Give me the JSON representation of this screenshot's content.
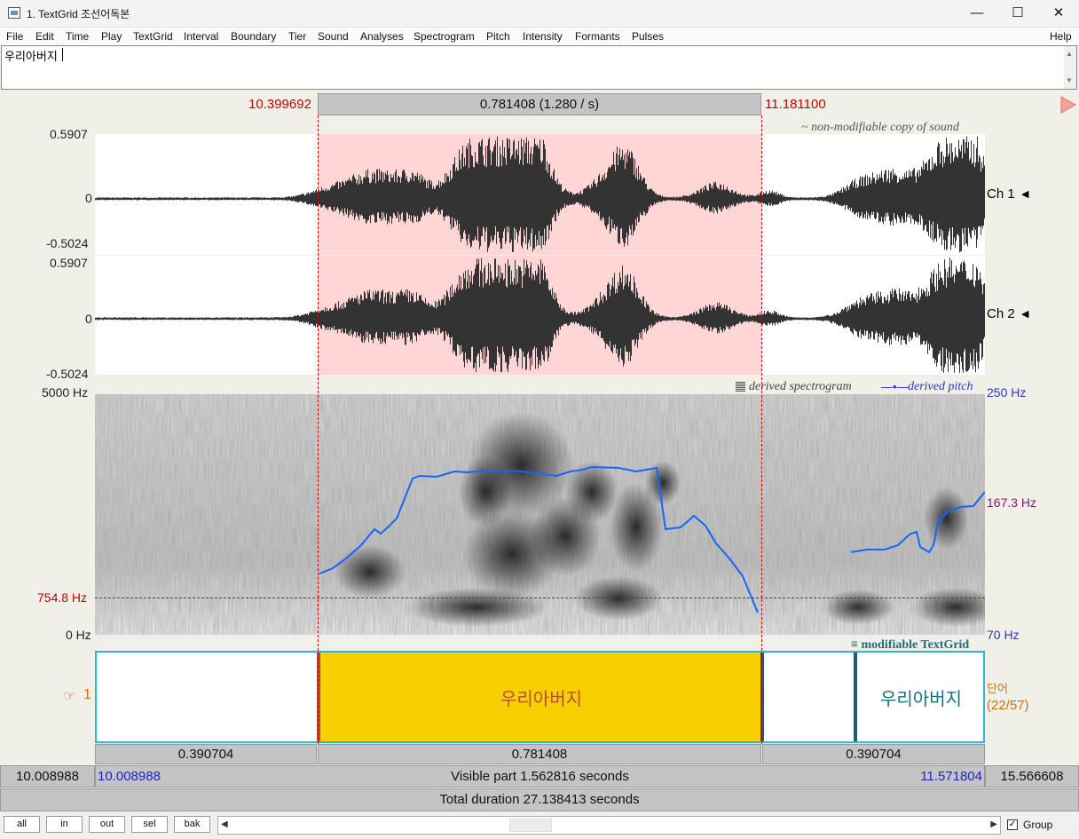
{
  "window": {
    "title": "1. TextGrid 조선어독본",
    "minimize": "—",
    "maximize": "☐",
    "close": "✕"
  },
  "menu": [
    "File",
    "Edit",
    "Time",
    "Play",
    "TextGrid",
    "Interval",
    "Boundary",
    "Tier",
    "Sound",
    "Analyses",
    "Spectrogram",
    "Pitch",
    "Intensity",
    "Formants",
    "Pulses"
  ],
  "help": "Help",
  "text_field": {
    "value": "우리아버지"
  },
  "selection": {
    "start": "10.399692",
    "end": "11.181100",
    "duration_label": "0.781408 (1.280 / s)"
  },
  "waveform": {
    "note": "~ non-modifiable copy of sound",
    "ch1": {
      "label": "Ch 1",
      "max": "0.5907",
      "zero": "0",
      "min": "-0.5024"
    },
    "ch2": {
      "label": "Ch 2",
      "max": "0.5907",
      "zero": "0",
      "min": "-0.5024"
    }
  },
  "spectrogram": {
    "legend_spec": "derived spectrogram",
    "legend_pitch": "derived pitch",
    "freq_max": "5000 Hz",
    "freq_min": "0 Hz",
    "cursor_freq": "754.8 Hz",
    "pitch_max": "250 Hz",
    "pitch_cursor": "167.3 Hz",
    "pitch_min": "70 Hz"
  },
  "textgrid": {
    "label": "modifiable TextGrid",
    "tier_number": "1",
    "tier_name": "단어",
    "tier_count": "(22/57)",
    "intervals": [
      "",
      "우리아버지",
      "",
      "우리아버지"
    ]
  },
  "durations": [
    "0.390704",
    "0.781408",
    "0.390704"
  ],
  "visible": {
    "outer_left": "10.008988",
    "left": "10.008988",
    "label": "Visible part 1.562816 seconds",
    "right": "11.571804",
    "outer_right": "15.566608"
  },
  "total": "Total duration 27.138413 seconds",
  "buttons": [
    "all",
    "in",
    "out",
    "sel",
    "bak"
  ],
  "group_label": "Group",
  "colors": {
    "selection": "#ffd5d5",
    "interval": "#f8cf00",
    "tier_border": "#29b8d8",
    "pitch": "#1060f0",
    "cursor": "#c00000"
  }
}
